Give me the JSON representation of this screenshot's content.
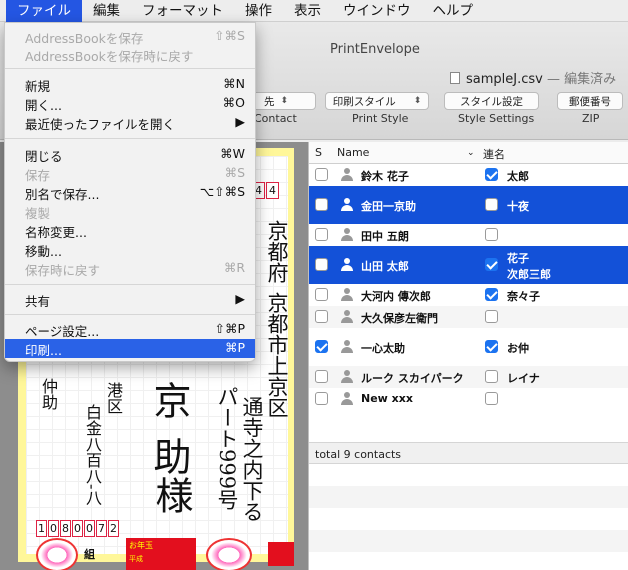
{
  "menubar": {
    "items": [
      "ファイル",
      "編集",
      "フォーマット",
      "操作",
      "表示",
      "ウインドウ",
      "ヘルプ"
    ]
  },
  "window": {
    "title": "PrintEnvelope",
    "doc_name": "sampleJ.csv",
    "doc_status": "— 編集済み"
  },
  "toolbar": {
    "contact_popup": "先",
    "contact_label": "Contact",
    "print_style_popup": "印刷スタイル",
    "print_style_label": "Print Style",
    "style_settings_button": "スタイル設定",
    "style_settings_label": "Style Settings",
    "zip_button": "郵便番号",
    "zip_label": "ZIP"
  },
  "file_menu": {
    "items": [
      {
        "label": "AddressBookを保存",
        "shortcut": "⇧⌘S",
        "enabled": false
      },
      {
        "label": "AddressBookを保存時に戻す",
        "shortcut": "",
        "enabled": false
      },
      {
        "label": "新規",
        "shortcut": "⌘N",
        "enabled": true
      },
      {
        "label": "開く...",
        "shortcut": "⌘O",
        "enabled": true
      },
      {
        "label": "最近使ったファイルを開く",
        "shortcut": "▶",
        "enabled": true
      },
      {
        "label": "閉じる",
        "shortcut": "⌘W",
        "enabled": true
      },
      {
        "label": "保存",
        "shortcut": "⌘S",
        "enabled": false
      },
      {
        "label": "別名で保存...",
        "shortcut": "⌥⇧⌘S",
        "enabled": true
      },
      {
        "label": "複製",
        "shortcut": "",
        "enabled": false
      },
      {
        "label": "名称変更...",
        "shortcut": "",
        "enabled": true
      },
      {
        "label": "移動...",
        "shortcut": "",
        "enabled": true
      },
      {
        "label": "保存時に戻す",
        "shortcut": "⌘R",
        "enabled": false
      },
      {
        "label": "共有",
        "shortcut": "▶",
        "enabled": true
      },
      {
        "label": "ページ設定...",
        "shortcut": "⇧⌘P",
        "enabled": true
      },
      {
        "label": "印刷...",
        "shortcut": "⌘P",
        "enabled": true,
        "highlighted": true
      }
    ]
  },
  "preview": {
    "zip_top_digits": [
      "4",
      "4"
    ],
    "addr_line1": "京都府",
    "addr_line2": "京都市上京区",
    "addr_line3": "通寺之内下る",
    "addr_line4": "パート999号",
    "recipient_name": "京助",
    "honorific": "様",
    "sender_name": "仲助",
    "sender_ward": "港区",
    "sender_addr": "白金八百八-八",
    "sender_zip": [
      "1",
      "0",
      "8",
      "0",
      "0",
      "7",
      "2"
    ],
    "stamp_text": "お年玉",
    "stamp_sub": "平成",
    "group_label": "組"
  },
  "contacts": {
    "headers": {
      "s": "S",
      "name": "Name",
      "rename": "連名"
    },
    "rows": [
      {
        "s": false,
        "name": "鈴木 花子",
        "r": true,
        "rname": "太郎",
        "sel": false
      },
      {
        "s": false,
        "name": "金田一京助",
        "r": false,
        "rname": "十夜",
        "sel": true
      },
      {
        "s": false,
        "name": "田中 五朗",
        "r": false,
        "rname": "",
        "sel": false
      },
      {
        "s": false,
        "name": "山田 太郎",
        "r": true,
        "rname": "花子",
        "rname2": "次郎三郎",
        "sel": true
      },
      {
        "s": false,
        "name": "大河内 傳次郎",
        "r": true,
        "rname": "奈々子",
        "sel": false
      },
      {
        "s": false,
        "name": "大久保彦左衛門",
        "r": false,
        "rname": "",
        "sel": false
      },
      {
        "s": true,
        "name": "一心太助",
        "r": true,
        "rname": "お仲",
        "sel": false
      },
      {
        "s": false,
        "name": "ルーク スカイパーク",
        "r": false,
        "rname": "レイナ",
        "sel": false
      },
      {
        "s": false,
        "name": "New xxx",
        "r": false,
        "rname": "",
        "sel": false
      }
    ],
    "footer": "total 9 contacts"
  },
  "colors": {
    "selection": "#1351d8",
    "menu_highlight": "#2a62e7",
    "envelope_border": "#fff79a",
    "stamp_red": "#e30f1e"
  }
}
